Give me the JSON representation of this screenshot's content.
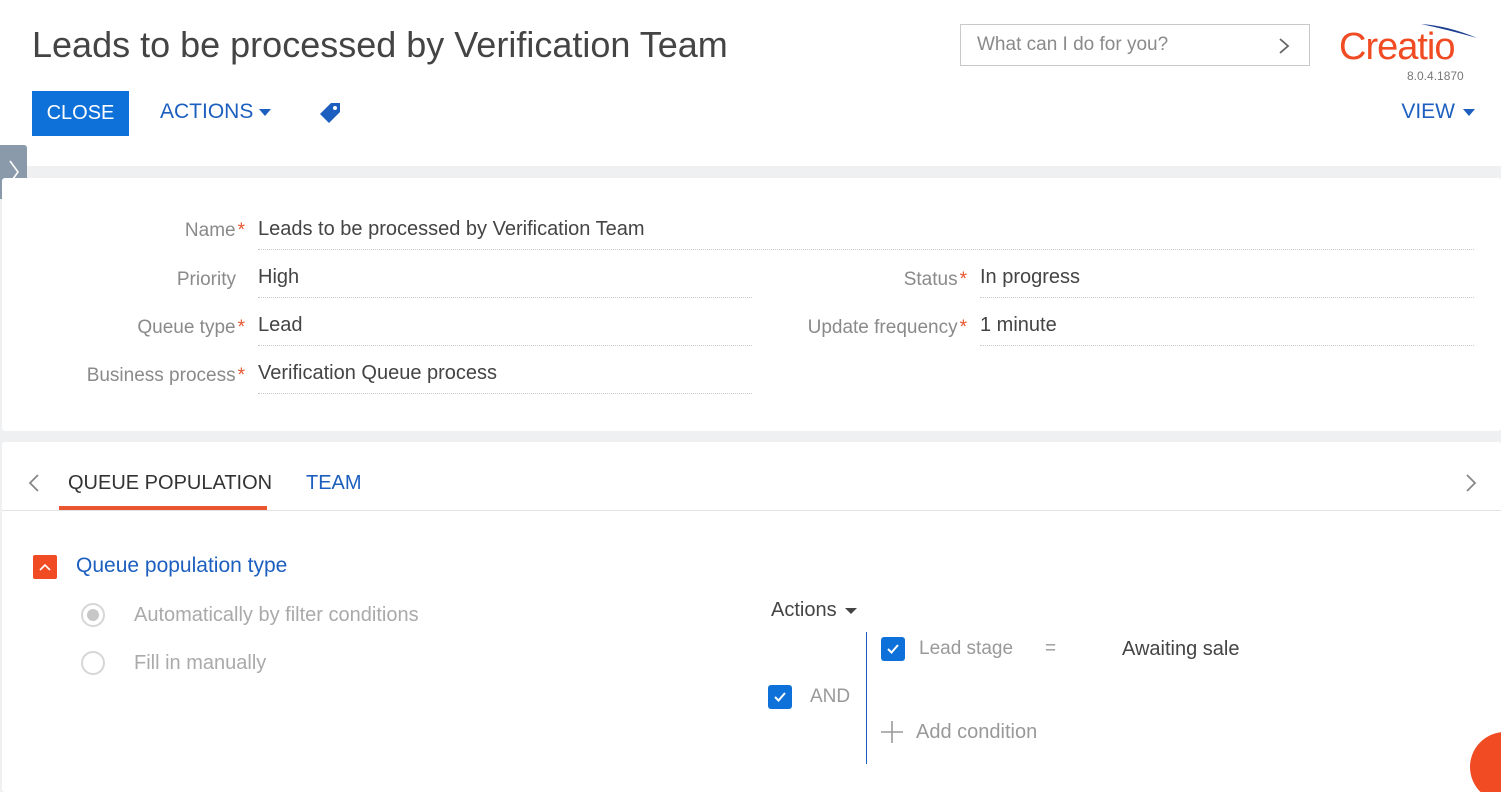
{
  "header": {
    "title": "Leads to be processed by Verification Team",
    "close_label": "CLOSE",
    "actions_label": "ACTIONS",
    "view_label": "VIEW",
    "search_placeholder": "What can I do for you?",
    "logo_text": "Creatio",
    "version": "8.0.4.1870"
  },
  "form": {
    "name": {
      "label": "Name",
      "value": "Leads to be processed by Verification Team"
    },
    "priority": {
      "label": "Priority",
      "value": "High"
    },
    "status": {
      "label": "Status",
      "value": "In progress"
    },
    "queue_type": {
      "label": "Queue type",
      "value": "Lead"
    },
    "update_frequency": {
      "label": "Update frequency",
      "value": "1 minute"
    },
    "business_process": {
      "label": "Business process",
      "value": "Verification Queue process"
    },
    "required_mark": "*"
  },
  "tabs": [
    {
      "label": "QUEUE POPULATION",
      "active": true
    },
    {
      "label": "TEAM",
      "active": false
    }
  ],
  "queue_population": {
    "section_title": "Queue population type",
    "options": [
      {
        "label": "Automatically by filter conditions",
        "selected": true
      },
      {
        "label": "Fill in manually",
        "selected": false
      }
    ],
    "filter": {
      "actions_label": "Actions",
      "group_operator": "AND",
      "conditions": [
        {
          "column": "Lead stage",
          "operator": "=",
          "value": "Awaiting sale",
          "enabled": true
        }
      ],
      "add_condition_label": "Add condition"
    }
  },
  "colors": {
    "primary": "#0d71d9",
    "link": "#1d5fbf",
    "accent": "#f04b23"
  }
}
